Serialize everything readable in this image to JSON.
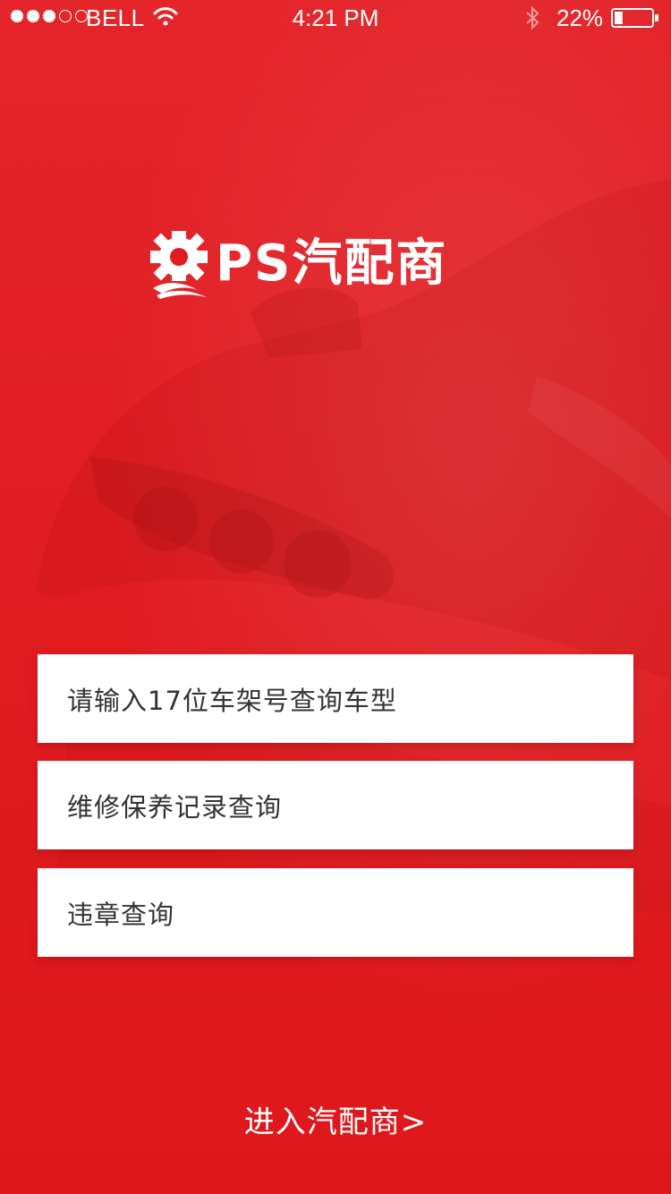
{
  "status_bar": {
    "signal_dots": [
      "full",
      "full",
      "full",
      "empty",
      "empty"
    ],
    "carrier": "BELL",
    "time": "4:21 PM",
    "battery_percent": "22%",
    "battery_level": 0.22
  },
  "logo": {
    "text": "PS汽配商",
    "icon": "gear-icon"
  },
  "options": [
    {
      "label": "请输入17位车架号查询车型"
    },
    {
      "label": "维修保养记录查询"
    },
    {
      "label": "违章查询"
    }
  ],
  "enter_link": "进入汽配商>",
  "colors": {
    "background": "#e21b1d",
    "card": "#ffffff",
    "card_text": "#333333",
    "text_light": "#ffffff"
  }
}
